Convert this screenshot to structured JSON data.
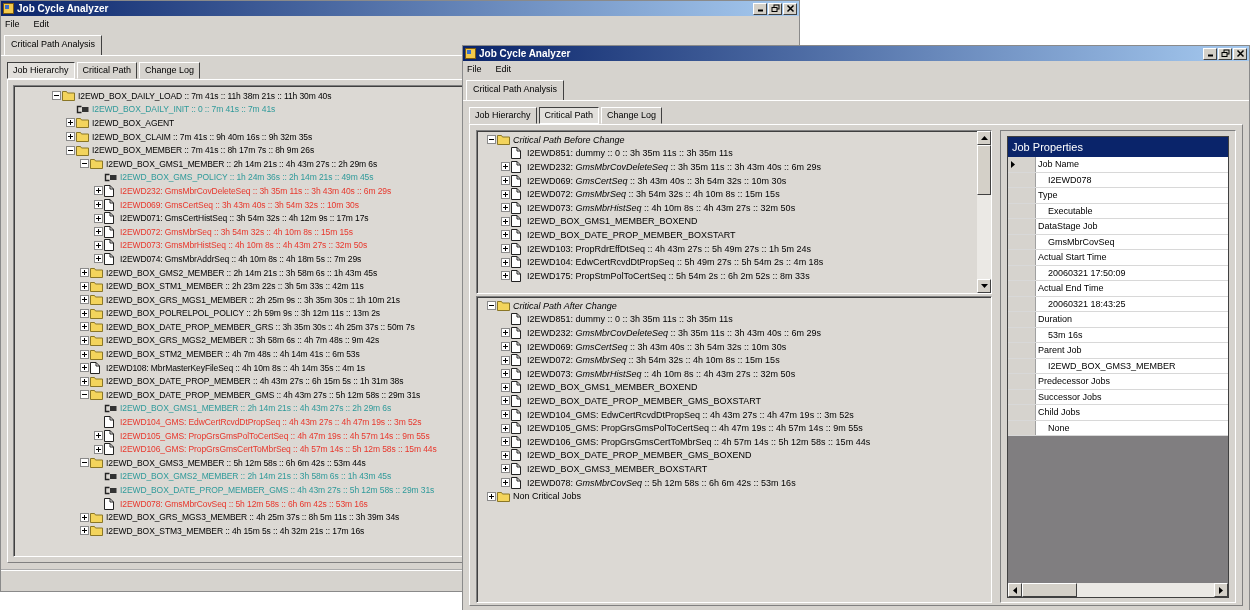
{
  "back_window": {
    "title": "Job Cycle Analyzer",
    "menu": [
      "File",
      "Edit"
    ],
    "outer_tabs": [
      {
        "label": "Critical Path Analysis",
        "selected": true
      }
    ],
    "inner_tabs": [
      {
        "label": "Job Hierarchy",
        "selected": true
      },
      {
        "label": "Critical Path",
        "selected": false
      },
      {
        "label": "Change Log",
        "selected": false
      }
    ],
    "hierarchy_tree": [
      {
        "text": "I2EWD_BOX_DAILY_LOAD :: 7m 41s :: 11h 38m 21s :: 11h 30m 40s",
        "kind": "folder",
        "expanded": true,
        "critical": false,
        "children": [
          {
            "text": "I2EWD_BOX_DAILY_INIT :: 0 :: 7m 41s :: 7m 41s",
            "kind": "link",
            "critical": false
          },
          {
            "text": "I2EWD_BOX_AGENT",
            "kind": "folder",
            "expanded": false,
            "critical": false
          },
          {
            "text": "I2EWD_BOX_CLAIM :: 7m 41s :: 9h 40m 16s :: 9h 32m 35s",
            "kind": "folder",
            "expanded": false,
            "critical": false
          },
          {
            "text": "I2EWD_BOX_MEMBER :: 7m 41s :: 8h 17m 7s :: 8h 9m 26s",
            "kind": "folder",
            "expanded": true,
            "critical": false,
            "children": [
              {
                "text": "I2EWD_BOX_GMS1_MEMBER :: 2h 14m 21s :: 4h 43m 27s :: 2h 29m 6s",
                "kind": "folder",
                "expanded": true,
                "critical": false,
                "children": [
                  {
                    "text": "I2EWD_BOX_GMS_POLICY :: 1h 24m 36s :: 2h 14m 21s :: 49m 45s",
                    "kind": "link",
                    "critical": false
                  },
                  {
                    "text": "I2EWD232: GmsMbrCovDeleteSeq :: 3h 35m 11s :: 3h 43m 40s :: 6m 29s",
                    "kind": "job",
                    "expanded": false,
                    "critical": true
                  },
                  {
                    "text": "I2EWD069: GmsCertSeq :: 3h 43m 40s :: 3h 54m 32s :: 10m 30s",
                    "kind": "job",
                    "expanded": false,
                    "critical": true
                  },
                  {
                    "text": "I2EWD071: GmsCertHistSeq :: 3h 54m 32s :: 4h 12m 9s :: 17m 17s",
                    "kind": "job",
                    "expanded": false,
                    "critical": false
                  },
                  {
                    "text": "I2EWD072: GmsMbrSeq :: 3h 54m 32s :: 4h 10m 8s :: 15m 15s",
                    "kind": "job",
                    "expanded": false,
                    "critical": true
                  },
                  {
                    "text": "I2EWD073: GmsMbrHistSeq :: 4h 10m 8s :: 4h 43m 27s :: 32m 50s",
                    "kind": "job",
                    "expanded": false,
                    "critical": true
                  },
                  {
                    "text": "I2EWD074: GmsMbrAddrSeq :: 4h 10m 8s :: 4h 18m 5s :: 7m 29s",
                    "kind": "job",
                    "expanded": false,
                    "critical": false
                  }
                ]
              },
              {
                "text": "I2EWD_BOX_GMS2_MEMBER :: 2h 14m 21s :: 3h 58m 6s :: 1h 43m 45s",
                "kind": "folder",
                "expanded": false,
                "critical": false
              },
              {
                "text": "I2EWD_BOX_STM1_MEMBER :: 2h 23m 22s :: 3h 5m 33s :: 42m 11s",
                "kind": "folder",
                "expanded": false,
                "critical": false
              },
              {
                "text": "I2EWD_BOX_GRS_MGS1_MEMBER :: 2h 25m 9s :: 3h 35m 30s :: 1h 10m 21s",
                "kind": "folder",
                "expanded": false,
                "critical": false
              },
              {
                "text": "I2EWD_BOX_POLRELPOL_POLICY :: 2h 59m 9s :: 3h 12m 11s :: 13m 2s",
                "kind": "folder",
                "expanded": false,
                "critical": false
              },
              {
                "text": "I2EWD_BOX_DATE_PROP_MEMBER_GRS :: 3h 35m 30s :: 4h 25m 37s :: 50m 7s",
                "kind": "folder",
                "expanded": false,
                "critical": false
              },
              {
                "text": "I2EWD_BOX_GRS_MGS2_MEMBER :: 3h 58m 6s :: 4h 7m 48s :: 9m 42s",
                "kind": "folder",
                "expanded": false,
                "critical": false
              },
              {
                "text": "I2EWD_BOX_STM2_MEMBER :: 4h 7m 48s :: 4h 14m 41s :: 6m 53s",
                "kind": "folder",
                "expanded": false,
                "critical": false
              },
              {
                "text": "I2EWD108: MbrMasterKeyFileSeq :: 4h 10m 8s :: 4h 14m 35s :: 4m 1s",
                "kind": "job",
                "expanded": false,
                "critical": false
              },
              {
                "text": "I2EWD_BOX_DATE_PROP_MEMBER :: 4h 43m 27s :: 6h 15m 5s :: 1h 31m 38s",
                "kind": "folder",
                "expanded": false,
                "critical": false
              },
              {
                "text": "I2EWD_BOX_DATE_PROP_MEMBER_GMS :: 4h 43m 27s :: 5h 12m 58s :: 29m 31s",
                "kind": "folder",
                "expanded": true,
                "critical": false,
                "children": [
                  {
                    "text": "I2EWD_BOX_GMS1_MEMBER :: 2h 14m 21s :: 4h 43m 27s :: 2h 29m 6s",
                    "kind": "link",
                    "critical": false
                  },
                  {
                    "text": "I2EWD104_GMS: EdwCertRcvdDtPropSeq :: 4h 43m 27s :: 4h 47m 19s :: 3m 52s",
                    "kind": "job",
                    "critical": true
                  },
                  {
                    "text": "I2EWD105_GMS: PropGrsGmsPolToCertSeq :: 4h 47m 19s :: 4h 57m 14s :: 9m 55s",
                    "kind": "job",
                    "expanded": false,
                    "critical": true
                  },
                  {
                    "text": "I2EWD106_GMS: PropGrsGmsCertToMbrSeq :: 4h 57m 14s :: 5h 12m 58s :: 15m 44s",
                    "kind": "job",
                    "expanded": false,
                    "critical": true
                  }
                ]
              },
              {
                "text": "I2EWD_BOX_GMS3_MEMBER :: 5h 12m 58s :: 6h 6m 42s :: 53m 44s",
                "kind": "folder",
                "expanded": true,
                "critical": false,
                "children": [
                  {
                    "text": "I2EWD_BOX_GMS2_MEMBER :: 2h 14m 21s :: 3h 58m 6s :: 1h 43m 45s",
                    "kind": "link",
                    "critical": false
                  },
                  {
                    "text": "I2EWD_BOX_DATE_PROP_MEMBER_GMS :: 4h 43m 27s :: 5h 12m 58s :: 29m 31s",
                    "kind": "link",
                    "critical": false
                  },
                  {
                    "text": "I2EWD078: GmsMbrCovSeq :: 5h 12m 58s :: 6h 6m 42s :: 53m 16s",
                    "kind": "job",
                    "critical": true
                  }
                ]
              },
              {
                "text": "I2EWD_BOX_GRS_MGS3_MEMBER :: 4h 25m 37s :: 8h 5m 11s :: 3h 39m 34s",
                "kind": "folder",
                "expanded": false,
                "critical": false
              },
              {
                "text": "I2EWD_BOX_STM3_MEMBER :: 4h 15m 5s :: 4h 32m 21s :: 17m 16s",
                "kind": "folder",
                "expanded": false,
                "critical": false
              }
            ]
          }
        ]
      }
    ]
  },
  "front_window": {
    "title": "Job Cycle Analyzer",
    "menu": [
      "File",
      "Edit"
    ],
    "outer_tabs": [
      {
        "label": "Critical Path Analysis",
        "selected": true
      }
    ],
    "inner_tabs": [
      {
        "label": "Job Hierarchy",
        "selected": false
      },
      {
        "label": "Critical Path",
        "selected": true
      },
      {
        "label": "Change Log",
        "selected": false
      }
    ],
    "critical_path_panes": [
      {
        "tree": [
          {
            "text": "Critical Path Before Change",
            "kind": "folder",
            "expanded": true,
            "italic": true,
            "children": [
              {
                "text": "I2EWD851: dummy :: 0 :: 3h 35m 11s :: 3h 35m 11s",
                "kind": "job"
              },
              {
                "text": "I2EWD232: *GmsMbrCovDeleteSeq* :: 3h 35m 11s :: 3h 43m 40s :: 6m 29s",
                "kind": "job",
                "expanded": false
              },
              {
                "text": "I2EWD069: *GmsCertSeq* :: 3h 43m 40s :: 3h 54m 32s :: 10m 30s",
                "kind": "job",
                "expanded": false
              },
              {
                "text": "I2EWD072: *GmsMbrSeq* :: 3h 54m 32s :: 4h 10m 8s :: 15m 15s",
                "kind": "job",
                "expanded": false
              },
              {
                "text": "I2EWD073: *GmsMbrHistSeq* :: 4h 10m 8s :: 4h 43m 27s :: 32m 50s",
                "kind": "job",
                "expanded": false
              },
              {
                "text": "I2EWD_BOX_GMS1_MEMBER_BOXEND",
                "kind": "job",
                "expanded": false
              },
              {
                "text": "I2EWD_BOX_DATE_PROP_MEMBER_BOXSTART",
                "kind": "job",
                "expanded": false
              },
              {
                "text": "I2EWD103: PropRdrEffDtSeq :: 4h 43m 27s :: 5h 49m 27s :: 1h 5m 24s",
                "kind": "job",
                "expanded": false
              },
              {
                "text": "I2EWD104: EdwCertRcvdDtPropSeq :: 5h 49m 27s :: 5h 54m 2s :: 4m 18s",
                "kind": "job",
                "expanded": false
              },
              {
                "text": "I2EWD175: PropStmPolToCertSeq :: 5h 54m 2s :: 6h 2m 52s :: 8m 33s",
                "kind": "job",
                "expanded": false
              }
            ]
          }
        ]
      },
      {
        "tree": [
          {
            "text": "Critical Path After Change",
            "kind": "folder",
            "expanded": true,
            "italic": true,
            "children": [
              {
                "text": "I2EWD851: dummy :: 0 :: 3h 35m 11s :: 3h 35m 11s",
                "kind": "job"
              },
              {
                "text": "I2EWD232: *GmsMbrCovDeleteSeq* :: 3h 35m 11s :: 3h 43m 40s :: 6m 29s",
                "kind": "job",
                "expanded": false
              },
              {
                "text": "I2EWD069: *GmsCertSeq* :: 3h 43m 40s :: 3h 54m 32s :: 10m 30s",
                "kind": "job",
                "expanded": false
              },
              {
                "text": "I2EWD072: *GmsMbrSeq* :: 3h 54m 32s :: 4h 10m 8s :: 15m 15s",
                "kind": "job",
                "expanded": false
              },
              {
                "text": "I2EWD073: *GmsMbrHistSeq* :: 4h 10m 8s :: 4h 43m 27s :: 32m 50s",
                "kind": "job",
                "expanded": false
              },
              {
                "text": "I2EWD_BOX_GMS1_MEMBER_BOXEND",
                "kind": "job",
                "expanded": false
              },
              {
                "text": "I2EWD_BOX_DATE_PROP_MEMBER_GMS_BOXSTART",
                "kind": "job",
                "expanded": false
              },
              {
                "text": "I2EWD104_GMS: EdwCertRcvdDtPropSeq :: 4h 43m 27s :: 4h 47m 19s :: 3m 52s",
                "kind": "job",
                "expanded": false
              },
              {
                "text": "I2EWD105_GMS: PropGrsGmsPolToCertSeq :: 4h 47m 19s :: 4h 57m 14s :: 9m 55s",
                "kind": "job",
                "expanded": false
              },
              {
                "text": "I2EWD106_GMS: PropGrsGmsCertToMbrSeq :: 4h 57m 14s :: 5h 12m 58s :: 15m 44s",
                "kind": "job",
                "expanded": false
              },
              {
                "text": "I2EWD_BOX_DATE_PROP_MEMBER_GMS_BOXEND",
                "kind": "job",
                "expanded": false
              },
              {
                "text": "I2EWD_BOX_GMS3_MEMBER_BOXSTART",
                "kind": "job",
                "expanded": false
              },
              {
                "text": "I2EWD078: *GmsMbrCovSeq* :: 5h 12m 58s :: 6h 6m 42s :: 53m 16s",
                "kind": "job",
                "expanded": false
              }
            ]
          },
          {
            "text": "Non Critical Jobs",
            "kind": "folder",
            "expanded": false,
            "italic": false
          }
        ]
      }
    ],
    "job_properties": {
      "title": "Job Properties",
      "rows": [
        {
          "text": "Job Name",
          "kind": "label",
          "selected": true
        },
        {
          "text": "I2EWD078",
          "kind": "value",
          "selected": false
        },
        {
          "text": "Type",
          "kind": "label",
          "selected": false
        },
        {
          "text": "Executable",
          "kind": "value",
          "selected": false
        },
        {
          "text": "DataStage Job",
          "kind": "label",
          "selected": false
        },
        {
          "text": "GmsMbrCovSeq",
          "kind": "value",
          "selected": false
        },
        {
          "text": "Actual Start Time",
          "kind": "label",
          "selected": false
        },
        {
          "text": "20060321 17:50:09",
          "kind": "value",
          "selected": false
        },
        {
          "text": "Actual End Time",
          "kind": "label",
          "selected": false
        },
        {
          "text": "20060321 18:43:25",
          "kind": "value",
          "selected": false
        },
        {
          "text": "Duration",
          "kind": "label",
          "selected": false
        },
        {
          "text": "53m 16s",
          "kind": "value",
          "selected": false
        },
        {
          "text": "Parent Job",
          "kind": "label",
          "selected": false
        },
        {
          "text": "I2EWD_BOX_GMS3_MEMBER",
          "kind": "value",
          "selected": false
        },
        {
          "text": "Predecessor Jobs",
          "kind": "label",
          "selected": false
        },
        {
          "text": "Successor Jobs",
          "kind": "label",
          "selected": false
        },
        {
          "text": "Child Jobs",
          "kind": "label",
          "selected": false
        },
        {
          "text": "None",
          "kind": "value",
          "selected": false
        }
      ]
    }
  }
}
